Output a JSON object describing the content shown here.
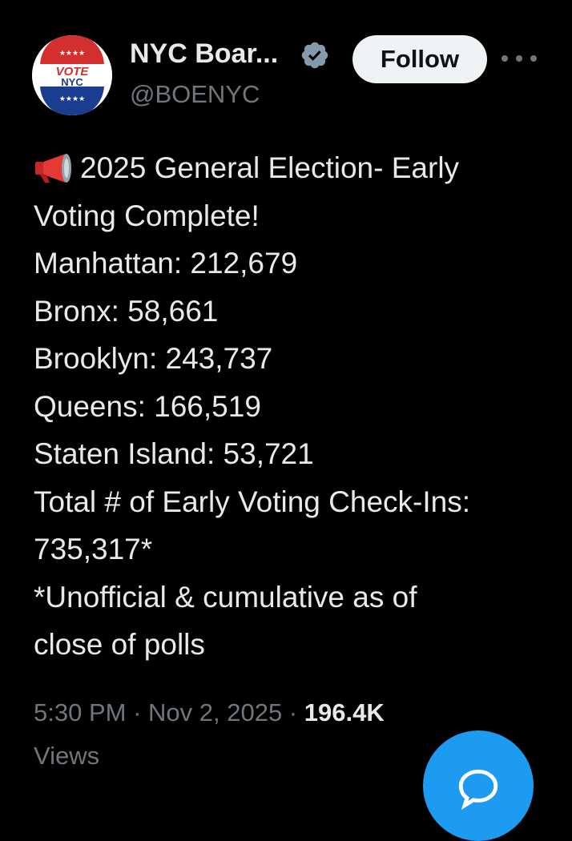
{
  "account": {
    "display_name": "NYC Boar...",
    "handle": "@BOENYC",
    "verified": true,
    "avatar": {
      "logo_text_line1": "VOTE",
      "logo_text_line2": "NYC",
      "stars": "★★★★"
    }
  },
  "actions": {
    "follow_label": "Follow",
    "more_icon": "more-horizontal-icon"
  },
  "tweet": {
    "emoji_icon": "megaphone-icon",
    "lines": [
      "2025 General Election- Early",
      "Voting Complete!",
      "Manhattan: 212,679",
      "Bronx: 58,661",
      "Brooklyn: 243,737",
      "Queens: 166,519",
      "Staten Island: 53,721",
      "Total # of Early Voting Check-Ins:",
      "735,317*",
      "*Unofficial & cumulative as of",
      "close of polls"
    ]
  },
  "meta": {
    "time": "5:30 PM",
    "separator": " · ",
    "date": "Nov 2, 2025",
    "views_count": "196.4K",
    "views_label": "Views"
  },
  "colors": {
    "background": "#000000",
    "text": "#e7e9ea",
    "muted": "#71767b",
    "accent": "#1d9bf0",
    "follow_bg": "#eff3f4"
  },
  "compose_fab": {
    "icon": "reply-bubble-icon"
  }
}
